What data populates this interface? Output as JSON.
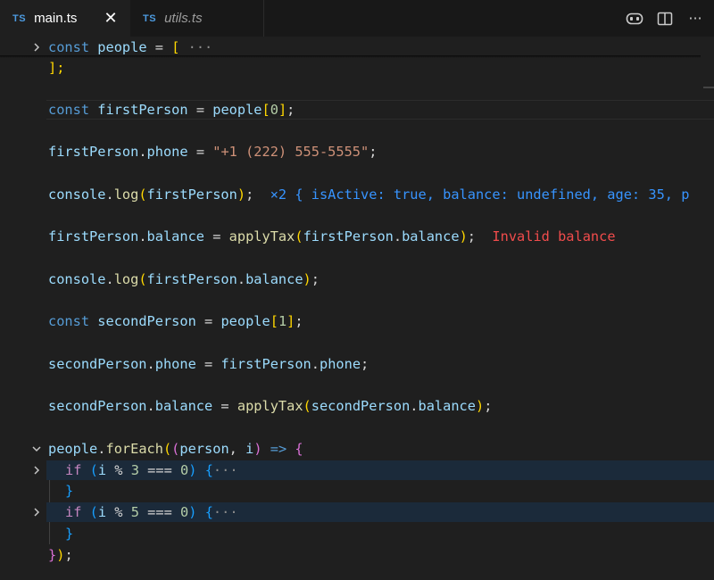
{
  "tabs": [
    {
      "badge": "TS",
      "name": "main.ts",
      "active": true,
      "close": "✕"
    },
    {
      "badge": "TS",
      "name": "utils.ts",
      "active": false
    }
  ],
  "toolbar": {
    "icons": [
      "copilot-icon",
      "split-editor-icon",
      "more-actions-icon"
    ],
    "more": "···"
  },
  "code": {
    "sticky": {
      "kw": "const",
      "name": "people",
      "eq": "=",
      "bracket": "[",
      "fold": "···"
    },
    "l1": "];",
    "l2": {
      "kw": "const",
      "name": "firstPerson",
      "eq": "=",
      "arr": "people",
      "ob": "[",
      "idx": "0",
      "cb": "]",
      "semi": ";"
    },
    "l3": {
      "obj": "firstPerson",
      "dot": ".",
      "prop": "phone",
      "eq": "=",
      "str": "\"+1 (222) 555-5555\"",
      "semi": ";"
    },
    "l4": {
      "obj": "console",
      "dot": ".",
      "fn": "log",
      "op": "(",
      "arg": "firstPerson",
      "cp": ")",
      "semi": ";",
      "inline": "×2 { isActive: true, balance: undefined, age: 35, p"
    },
    "l5": {
      "obj": "firstPerson",
      "dot": ".",
      "prop": "balance",
      "eq": "=",
      "fn": "applyTax",
      "op": "(",
      "aobj": "firstPerson",
      "aprop": "balance",
      "cp": ")",
      "semi": ";",
      "inline": "Invalid balance"
    },
    "l6": {
      "obj": "console",
      "dot": ".",
      "fn": "log",
      "op": "(",
      "aobj": "firstPerson",
      "aprop": "balance",
      "cp": ")",
      "semi": ";"
    },
    "l7": {
      "kw": "const",
      "name": "secondPerson",
      "eq": "=",
      "arr": "people",
      "ob": "[",
      "idx": "1",
      "cb": "]",
      "semi": ";"
    },
    "l8": {
      "obj": "secondPerson",
      "dot": ".",
      "prop": "phone",
      "eq": "=",
      "robj": "firstPerson",
      "rprop": "phone",
      "semi": ";"
    },
    "l9": {
      "obj": "secondPerson",
      "dot": ".",
      "prop": "balance",
      "eq": "=",
      "fn": "applyTax",
      "op": "(",
      "aobj": "secondPerson",
      "aprop": "balance",
      "cp": ")",
      "semi": ";"
    },
    "l10": {
      "obj": "people",
      "dot": ".",
      "fn": "forEach",
      "op": "(",
      "op2": "(",
      "p1": "person",
      "comma": ",",
      "p2": "i",
      "cp2": ")",
      "arrow": "=>",
      "brace": "{"
    },
    "l11": {
      "kw": "if",
      "op": "(",
      "var": "i",
      "mod": "%",
      "num": "3",
      "eq": "===",
      "zero": "0",
      "cp": ")",
      "brace": "{",
      "fold": "···"
    },
    "l12": "}",
    "l13": {
      "kw": "if",
      "op": "(",
      "var": "i",
      "mod": "%",
      "num": "5",
      "eq": "===",
      "zero": "0",
      "cp": ")",
      "brace": "{",
      "fold": "···"
    },
    "l14": "}",
    "l15": {
      "brace": "}",
      "cp": ")",
      "semi": ";"
    }
  }
}
